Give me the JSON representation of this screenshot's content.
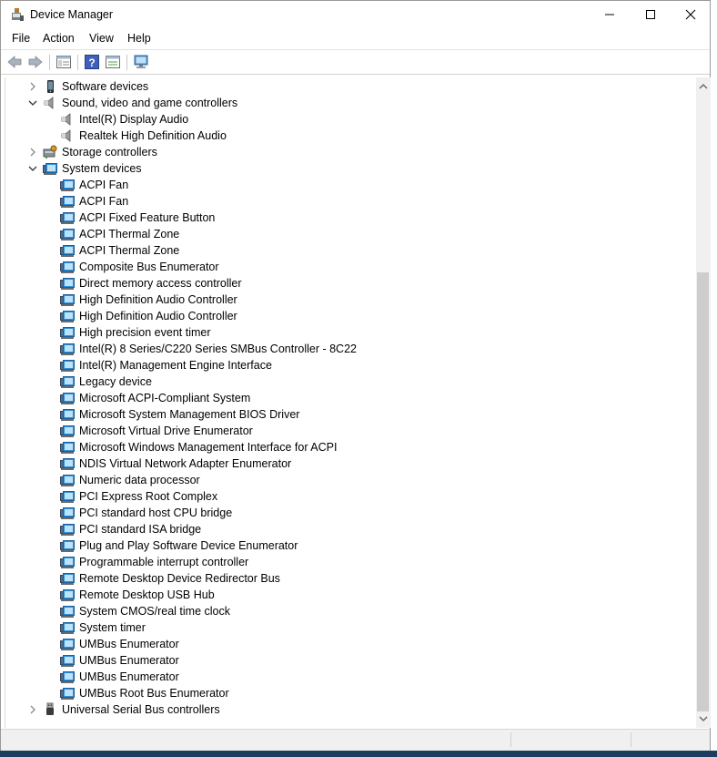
{
  "window": {
    "title": "Device Manager",
    "icon": "device-manager-icon",
    "controls": [
      "minimize-icon",
      "maximize-icon",
      "close-icon"
    ]
  },
  "menu": [
    "File",
    "Action",
    "View",
    "Help"
  ],
  "toolbar": [
    "back-icon",
    "forward-icon",
    "show-hide-console-tree-icon",
    "help-icon",
    "properties-icon",
    "scan-hardware-icon"
  ],
  "tree": {
    "items": [
      {
        "label": "Software devices",
        "level": 0,
        "state": "collapsed",
        "icon": "software-devices-icon"
      },
      {
        "label": "Sound, video and game controllers",
        "level": 0,
        "state": "expanded",
        "icon": "speaker-icon"
      },
      {
        "label": "Intel(R) Display Audio",
        "level": 1,
        "state": "leaf",
        "icon": "speaker-icon"
      },
      {
        "label": "Realtek High Definition Audio",
        "level": 1,
        "state": "leaf",
        "icon": "speaker-icon"
      },
      {
        "label": "Storage controllers",
        "level": 0,
        "state": "collapsed",
        "icon": "storage-controller-icon"
      },
      {
        "label": "System devices",
        "level": 0,
        "state": "expanded",
        "icon": "system-device-icon"
      },
      {
        "label": "ACPI Fan",
        "level": 1,
        "state": "leaf",
        "icon": "system-device-icon"
      },
      {
        "label": "ACPI Fan",
        "level": 1,
        "state": "leaf",
        "icon": "system-device-icon"
      },
      {
        "label": "ACPI Fixed Feature Button",
        "level": 1,
        "state": "leaf",
        "icon": "system-device-icon"
      },
      {
        "label": "ACPI Thermal Zone",
        "level": 1,
        "state": "leaf",
        "icon": "system-device-icon"
      },
      {
        "label": "ACPI Thermal Zone",
        "level": 1,
        "state": "leaf",
        "icon": "system-device-icon"
      },
      {
        "label": "Composite Bus Enumerator",
        "level": 1,
        "state": "leaf",
        "icon": "system-device-icon"
      },
      {
        "label": "Direct memory access controller",
        "level": 1,
        "state": "leaf",
        "icon": "system-device-icon"
      },
      {
        "label": "High Definition Audio Controller",
        "level": 1,
        "state": "leaf",
        "icon": "system-device-icon"
      },
      {
        "label": "High Definition Audio Controller",
        "level": 1,
        "state": "leaf",
        "icon": "system-device-icon"
      },
      {
        "label": "High precision event timer",
        "level": 1,
        "state": "leaf",
        "icon": "system-device-icon"
      },
      {
        "label": "Intel(R) 8 Series/C220 Series SMBus Controller - 8C22",
        "level": 1,
        "state": "leaf",
        "icon": "system-device-icon"
      },
      {
        "label": "Intel(R) Management Engine Interface",
        "level": 1,
        "state": "leaf",
        "icon": "system-device-icon"
      },
      {
        "label": "Legacy device",
        "level": 1,
        "state": "leaf",
        "icon": "system-device-icon"
      },
      {
        "label": "Microsoft ACPI-Compliant System",
        "level": 1,
        "state": "leaf",
        "icon": "system-device-icon"
      },
      {
        "label": "Microsoft System Management BIOS Driver",
        "level": 1,
        "state": "leaf",
        "icon": "system-device-icon"
      },
      {
        "label": "Microsoft Virtual Drive Enumerator",
        "level": 1,
        "state": "leaf",
        "icon": "system-device-icon"
      },
      {
        "label": "Microsoft Windows Management Interface for ACPI",
        "level": 1,
        "state": "leaf",
        "icon": "system-device-icon"
      },
      {
        "label": "NDIS Virtual Network Adapter Enumerator",
        "level": 1,
        "state": "leaf",
        "icon": "system-device-icon"
      },
      {
        "label": "Numeric data processor",
        "level": 1,
        "state": "leaf",
        "icon": "system-device-icon"
      },
      {
        "label": "PCI Express Root Complex",
        "level": 1,
        "state": "leaf",
        "icon": "system-device-icon"
      },
      {
        "label": "PCI standard host CPU bridge",
        "level": 1,
        "state": "leaf",
        "icon": "system-device-icon"
      },
      {
        "label": "PCI standard ISA bridge",
        "level": 1,
        "state": "leaf",
        "icon": "system-device-icon"
      },
      {
        "label": "Plug and Play Software Device Enumerator",
        "level": 1,
        "state": "leaf",
        "icon": "system-device-icon"
      },
      {
        "label": "Programmable interrupt controller",
        "level": 1,
        "state": "leaf",
        "icon": "system-device-icon"
      },
      {
        "label": "Remote Desktop Device Redirector Bus",
        "level": 1,
        "state": "leaf",
        "icon": "system-device-icon"
      },
      {
        "label": "Remote Desktop USB Hub",
        "level": 1,
        "state": "leaf",
        "icon": "system-device-icon"
      },
      {
        "label": "System CMOS/real time clock",
        "level": 1,
        "state": "leaf",
        "icon": "system-device-icon"
      },
      {
        "label": "System timer",
        "level": 1,
        "state": "leaf",
        "icon": "system-device-icon"
      },
      {
        "label": "UMBus Enumerator",
        "level": 1,
        "state": "leaf",
        "icon": "system-device-icon"
      },
      {
        "label": "UMBus Enumerator",
        "level": 1,
        "state": "leaf",
        "icon": "system-device-icon"
      },
      {
        "label": "UMBus Enumerator",
        "level": 1,
        "state": "leaf",
        "icon": "system-device-icon"
      },
      {
        "label": "UMBus Root Bus Enumerator",
        "level": 1,
        "state": "leaf",
        "icon": "system-device-icon"
      },
      {
        "label": "Universal Serial Bus controllers",
        "level": 0,
        "state": "collapsed",
        "icon": "usb-icon"
      }
    ]
  },
  "scrollbar": {
    "icons": [
      "scroll-up-icon",
      "scroll-down-icon"
    ]
  },
  "colors": {
    "accent": "#1e90ff",
    "title_bar": "#ffffff",
    "taskbar": "#1d3d5e"
  }
}
